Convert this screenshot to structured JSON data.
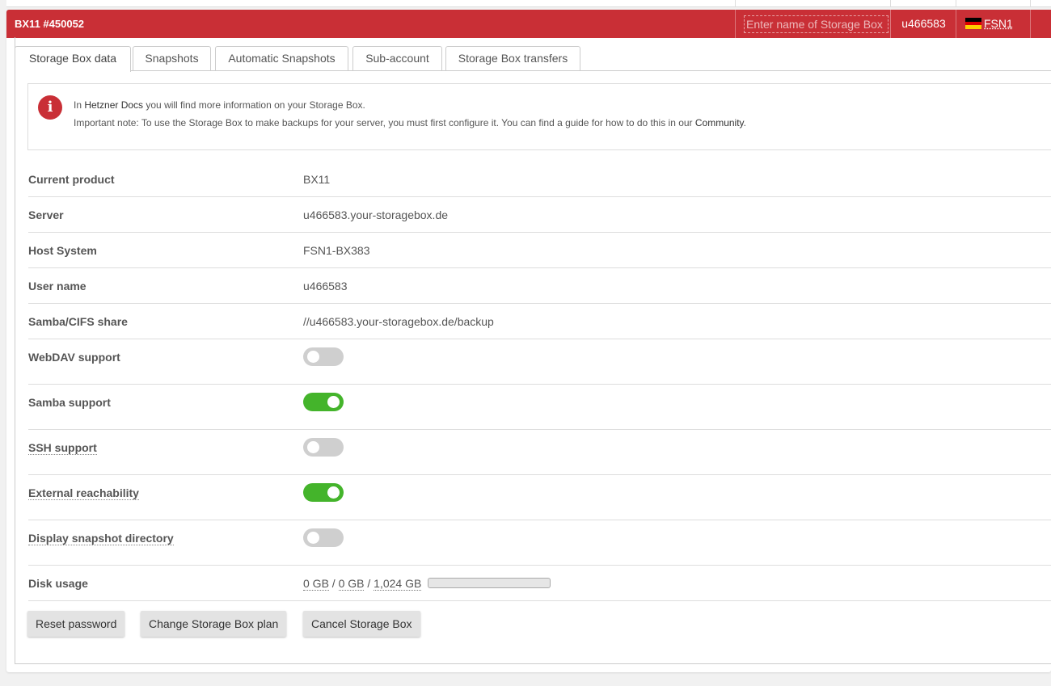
{
  "header": {
    "title": "BX11 #450052",
    "name_placeholder": "Enter name of Storage Box",
    "username": "u466583",
    "location": "FSN1",
    "flag_colors": [
      "#000000",
      "#dd0000",
      "#ffce00"
    ]
  },
  "tabs": [
    {
      "label": "Storage Box data",
      "active": true
    },
    {
      "label": "Snapshots"
    },
    {
      "label": "Automatic Snapshots"
    },
    {
      "label": "Sub-account"
    },
    {
      "label": "Storage Box transfers"
    }
  ],
  "info": {
    "line1_pre": "In ",
    "line1_link": "Hetzner Docs",
    "line1_post": " you will find more information on your Storage Box.",
    "line2_pre": "Important note: To use the Storage Box to make backups for your server, you must first configure it. You can find a guide for how to do this in our ",
    "line2_link": "Community",
    "line2_post": ".",
    "icon": "info-icon"
  },
  "details": {
    "product": {
      "label": "Current product",
      "value": "BX11"
    },
    "server": {
      "label": "Server",
      "value": "u466583.your-storagebox.de"
    },
    "host": {
      "label": "Host System",
      "value": "FSN1-BX383"
    },
    "user": {
      "label": "User name",
      "value": "u466583"
    },
    "samba_share": {
      "label": "Samba/CIFS share",
      "value": "//u466583.your-storagebox.de/backup"
    }
  },
  "toggles": {
    "webdav": {
      "label": "WebDAV support",
      "on": false
    },
    "samba": {
      "label": "Samba support",
      "on": true
    },
    "ssh": {
      "label": "SSH support",
      "on": false
    },
    "external": {
      "label": "External reachability",
      "on": true
    },
    "snapshot_dir": {
      "label": "Display snapshot directory",
      "on": false
    }
  },
  "disk": {
    "label": "Disk usage",
    "used": "0 GB",
    "snapshots": "0 GB",
    "total": "1,024 GB",
    "sep": "/",
    "fraction": 0
  },
  "buttons": {
    "reset": "Reset password",
    "change": "Change Storage Box plan",
    "cancel": "Cancel Storage Box"
  },
  "colors": {
    "brand": "#c92f36",
    "toggle_on": "#44b42b",
    "toggle_off": "#cfcfcf"
  }
}
